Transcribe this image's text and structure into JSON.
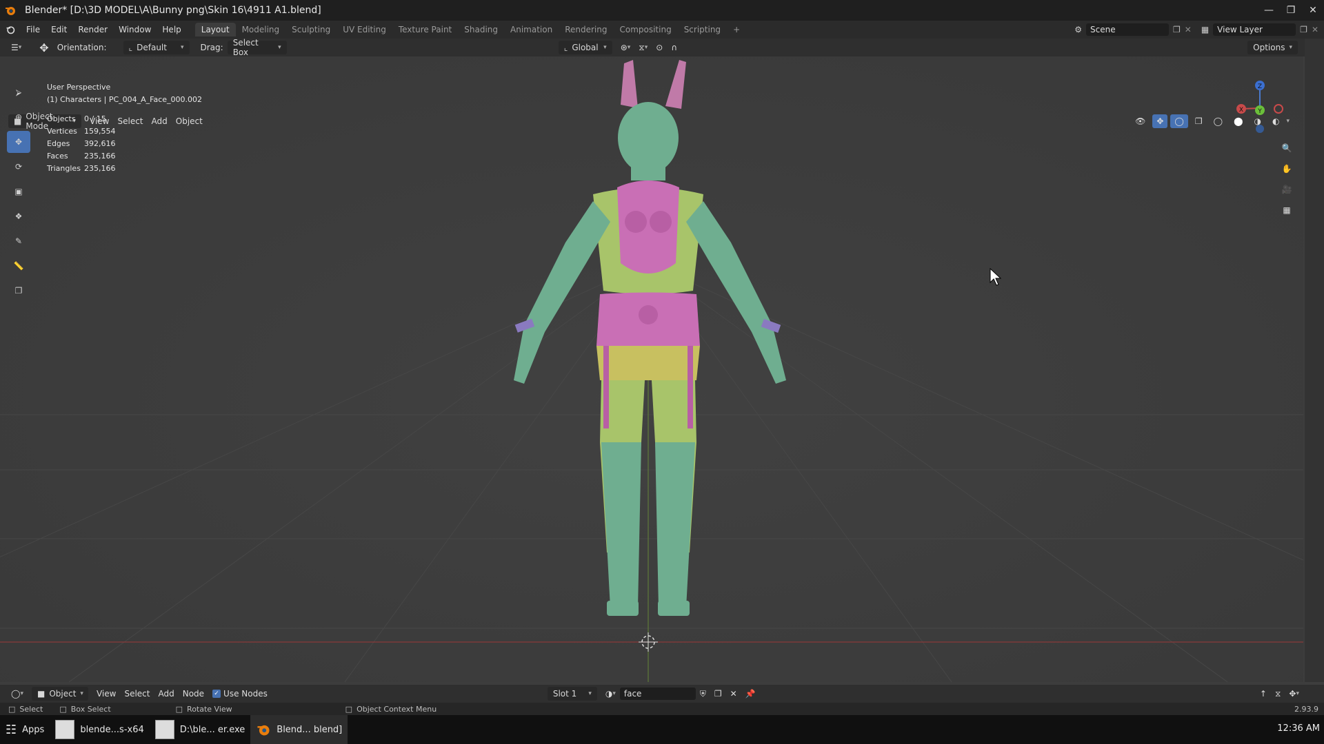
{
  "window": {
    "title": "Blender* [D:\\3D MODEL\\A\\Bunny png\\Skin 16\\4911 A1.blend]",
    "minimize_icon": "minimize-icon",
    "maximize_icon": "restore-icon",
    "close_icon": "close-icon"
  },
  "menubar": {
    "items": [
      "File",
      "Edit",
      "Render",
      "Window",
      "Help"
    ],
    "tabs": [
      "Layout",
      "Modeling",
      "Sculpting",
      "UV Editing",
      "Texture Paint",
      "Shading",
      "Animation",
      "Rendering",
      "Compositing",
      "Scripting"
    ],
    "active_tab": "Layout",
    "add_tab": "+",
    "scene": "Scene",
    "view_layer": "View Layer"
  },
  "toolheader": {
    "orientation_label": "Orientation:",
    "orientation_value": "Default",
    "drag_label": "Drag:",
    "drag_value": "Select Box",
    "transform_orientation": "Global",
    "options": "Options"
  },
  "viewport_header": {
    "mode": "Object Mode",
    "menus": [
      "View",
      "Select",
      "Add",
      "Object"
    ]
  },
  "overlay": {
    "perspective": "User Perspective",
    "context": "(1) Characters | PC_004_A_Face_000.002",
    "stats": [
      {
        "label": "Objects",
        "value": "0 / 15"
      },
      {
        "label": "Vertices",
        "value": "159,554"
      },
      {
        "label": "Edges",
        "value": "392,616"
      },
      {
        "label": "Faces",
        "value": "235,166"
      },
      {
        "label": "Triangles",
        "value": "235,166"
      }
    ]
  },
  "node_header": {
    "editor": "Object",
    "menus": [
      "View",
      "Select",
      "Add",
      "Node"
    ],
    "use_nodes": "Use Nodes",
    "slot": "Slot 1",
    "material": "face"
  },
  "statusbar": {
    "select": "Select",
    "box_select": "Box Select",
    "rotate_view": "Rotate View",
    "context_menu": "Object Context Menu",
    "version": "2.93.9"
  },
  "taskbar": {
    "apps": "Apps",
    "tasks": [
      "blende...s-x64",
      "D:\\ble... er.exe",
      "Blend... blend]"
    ],
    "clock": "12:36 AM"
  },
  "colors": {
    "accent": "#4772b3",
    "body_green": "#6fae90",
    "body_lime": "#a8c46a",
    "body_pink": "#c96fb5",
    "body_yellow": "#c8c060"
  }
}
